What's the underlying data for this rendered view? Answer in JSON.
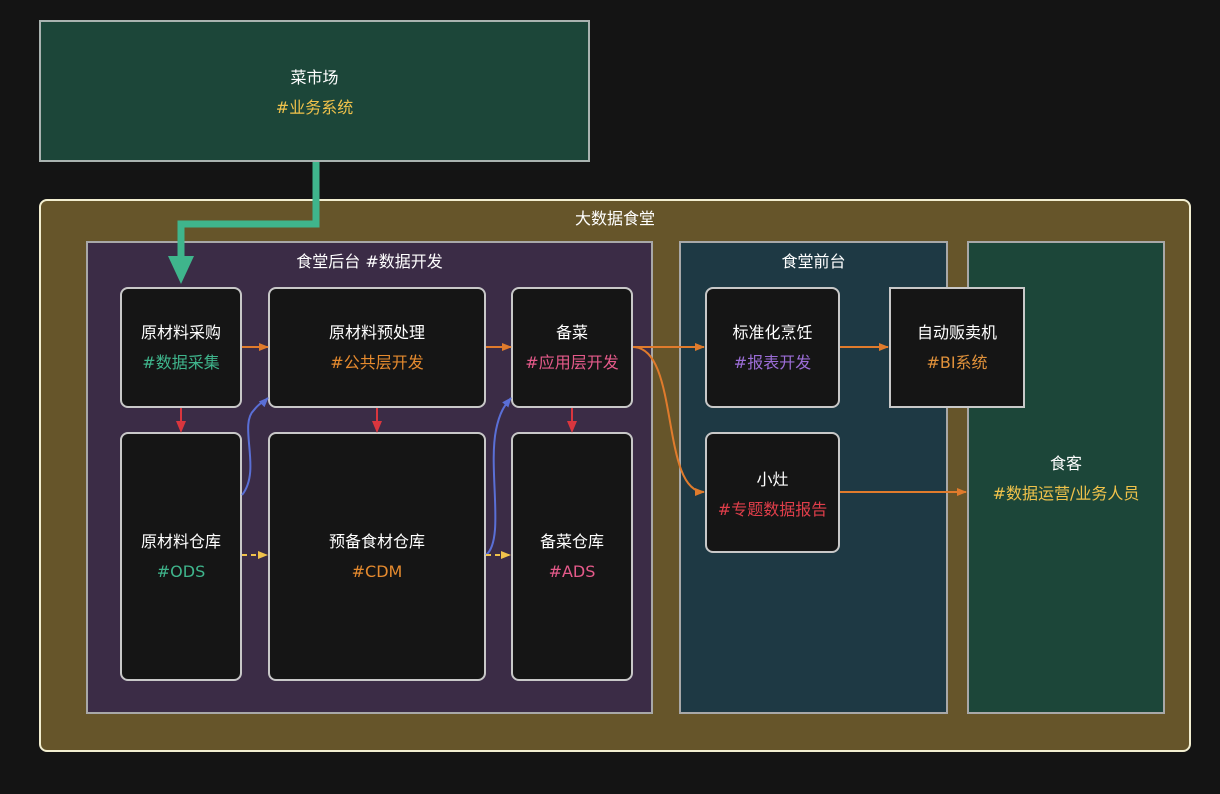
{
  "market": {
    "title": "菜市场",
    "tag": "#业务系统"
  },
  "canteen": {
    "title": "大数据食堂"
  },
  "backend": {
    "title": "食堂后台 #数据开发"
  },
  "frontend": {
    "title": "食堂前台"
  },
  "nodes": {
    "raw_purchase": {
      "title": "原材料采购",
      "tag": "#数据采集"
    },
    "raw_preprocess": {
      "title": "原材料预处理",
      "tag": "#公共层开发"
    },
    "prepare_dish": {
      "title": "备菜",
      "tag": "#应用层开发"
    },
    "raw_warehouse": {
      "title": "原材料仓库",
      "tag": "#ODS"
    },
    "prepared_warehouse": {
      "title": "预备食材仓库",
      "tag": "#CDM"
    },
    "dish_warehouse": {
      "title": "备菜仓库",
      "tag": "#ADS"
    },
    "standard_cooking": {
      "title": "标准化烹饪",
      "tag": "#报表开发"
    },
    "vending_machine": {
      "title": "自动贩卖机",
      "tag": "#BI系统"
    },
    "small_stove": {
      "title": "小灶",
      "tag": "#专题数据报告"
    },
    "diner": {
      "title": "食客",
      "tag": "#数据运营/业务人员"
    }
  },
  "colors": {
    "market_fill": "#1c4639",
    "canteen_fill": "#66552a",
    "backend_fill": "#3b2c46",
    "frontend_fill": "#1e3944",
    "node_fill": "#151515",
    "link_green": "#3fb58c",
    "link_orange": "#e07b2c",
    "link_red": "#d9363e",
    "link_blue": "#5a6fd6",
    "link_yellow": "#f0c24b"
  }
}
